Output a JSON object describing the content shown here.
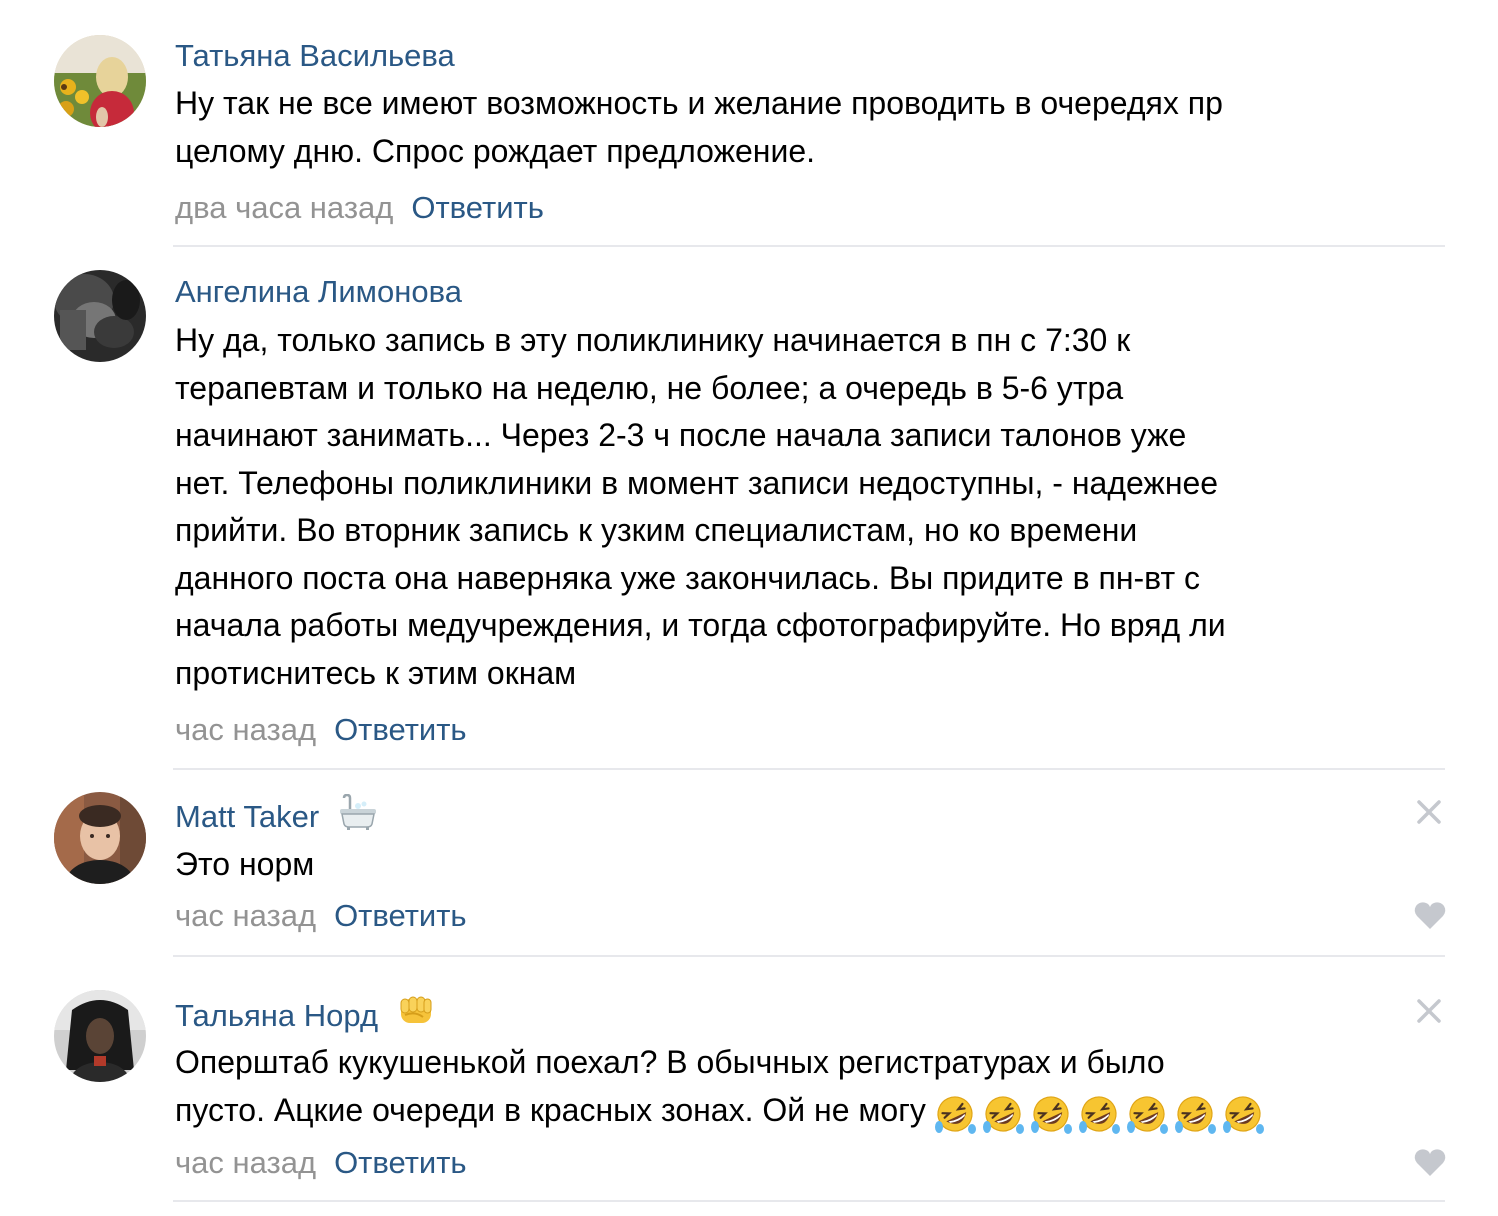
{
  "comments": [
    {
      "author": "Татьяна Васильева",
      "lines": [
        "Ну так не все имеют возможность и желание проводить в очередях пр",
        "целому дню. Спрос рождает предложение."
      ],
      "time": "два часа назад",
      "reply_label": "Ответить"
    },
    {
      "author": "Ангелина Лимонова",
      "lines": [
        "Ну да, только запись в эту поликлинику начинается в пн с 7:30 к",
        "терапевтам и только на неделю, не более; а очередь в 5-6 утра",
        "начинают занимать... Через 2-3 ч после начала записи талонов уже",
        "нет. Телефоны поликлиники в момент записи недоступны, - надежнее",
        "прийти. Во вторник запись к узким специалистам, но ко времени",
        "данного поста она наверняка уже закончилась. Вы придите в пн-вт с",
        "начала работы медучреждения, и тогда сфотографируйте. Но вряд ли",
        "протиснитесь к этим окнам"
      ],
      "time": "час назад",
      "reply_label": "Ответить"
    },
    {
      "author": "Matt Taker",
      "author_emoji": "bathtub-icon",
      "lines": [
        "Это норм"
      ],
      "time": "час назад",
      "reply_label": "Ответить"
    },
    {
      "author": "Тальяна Норд",
      "author_emoji": "fist-icon",
      "lines": [
        "Оперштаб кукушенькой поехал? В обычных регистратурах и было",
        "пусто. Ацкие очереди в красных зонах. Ой не могу"
      ],
      "trailing_emoji": "rolling-on-floor-laughing-icon",
      "trailing_emoji_count": 7,
      "time": "час назад",
      "reply_label": "Ответить"
    }
  ],
  "icons": {
    "close": "close-icon",
    "like": "heart-icon"
  },
  "colors": {
    "link": "#2a5885",
    "muted": "#939393",
    "divider": "#e7e8ec",
    "icon_gray": "#c5c8ce"
  }
}
